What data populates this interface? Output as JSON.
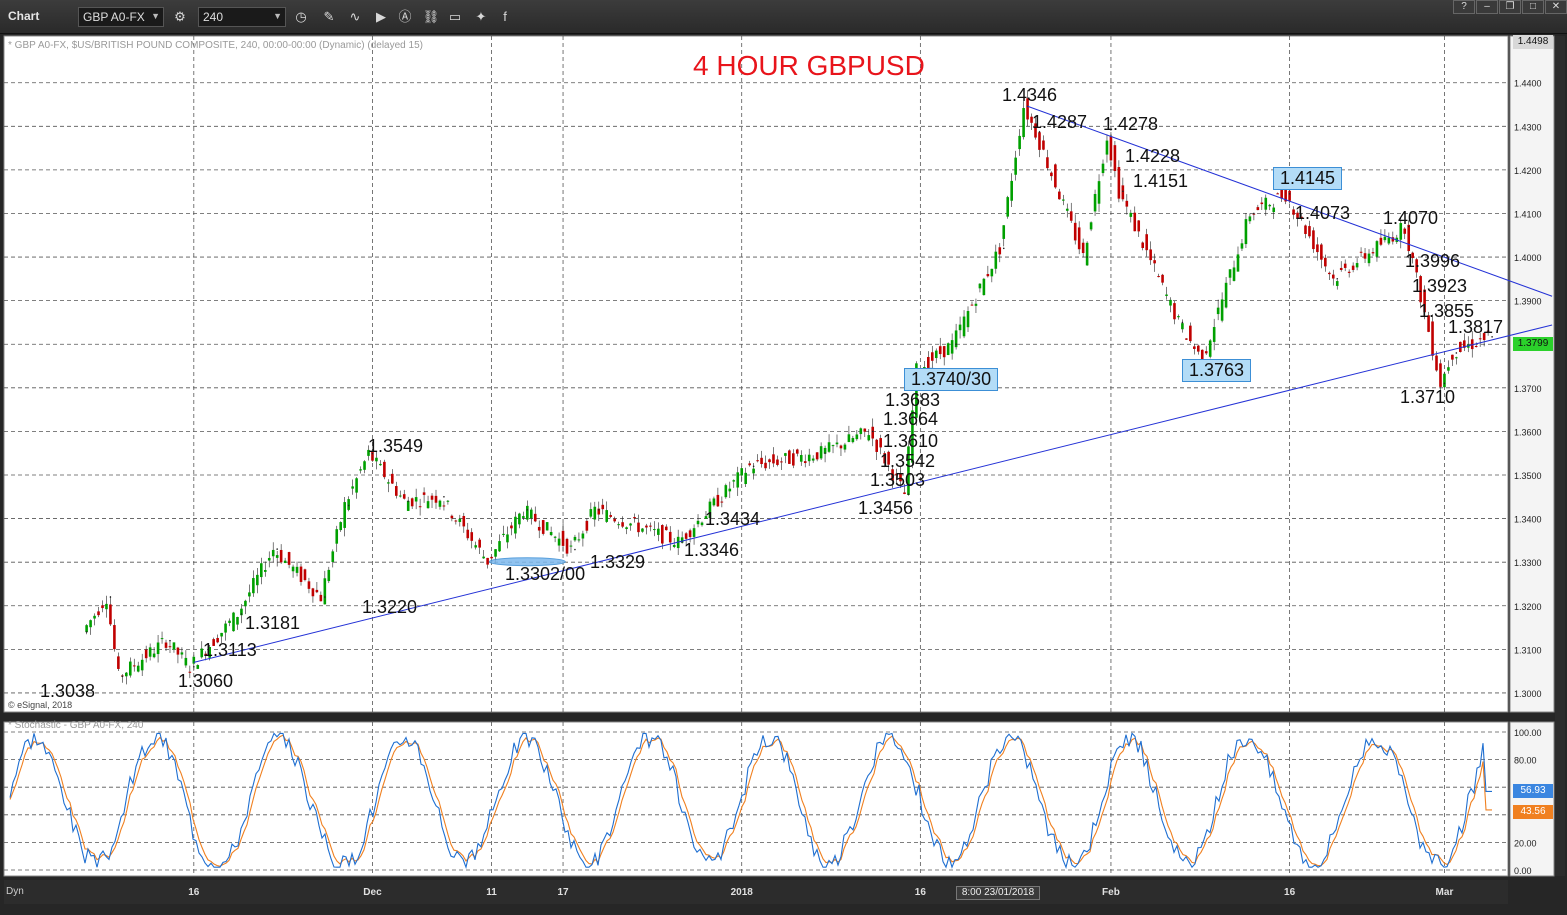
{
  "toolbar": {
    "window_title": "Chart",
    "symbol": "GBP A0-FX",
    "symbol_superscript": "15",
    "interval": "240"
  },
  "chart": {
    "symbol_notice": "* GBP A0-FX, $US/BRITISH POUND COMPOSITE, 240, 00:00-00:00 (Dynamic) (delayed 15)",
    "copyright": "© eSignal, 2018",
    "title": "4 HOUR GBPUSD",
    "stochastic_legend": "* Stochastic - GBP A0-FX, 240",
    "status_left": "Dyn",
    "crosshair_date": "8:00 23/01/2018"
  },
  "price_labels": [
    {
      "text": "1.4346"
    },
    {
      "text": "1.4287"
    },
    {
      "text": "1.4278"
    },
    {
      "text": "1.4228"
    },
    {
      "text": "1.4151"
    },
    {
      "text": "1.4073"
    },
    {
      "text": "1.4070"
    },
    {
      "text": "1.3996"
    },
    {
      "text": "1.3923"
    },
    {
      "text": "1.3855"
    },
    {
      "text": "1.3817"
    },
    {
      "text": "1.3710"
    },
    {
      "text": "1.3683"
    },
    {
      "text": "1.3664"
    },
    {
      "text": "1.3610"
    },
    {
      "text": "1.3542"
    },
    {
      "text": "1.3503"
    },
    {
      "text": "1.3456"
    },
    {
      "text": "1.3549"
    },
    {
      "text": "1.3434"
    },
    {
      "text": "1.3346"
    },
    {
      "text": "1.3329"
    },
    {
      "text": "1.3302/00"
    },
    {
      "text": "1.3220"
    },
    {
      "text": "1.3181"
    },
    {
      "text": "1.3113"
    },
    {
      "text": "1.3060"
    },
    {
      "text": "1.3038"
    }
  ],
  "boxed_labels": [
    {
      "text": "1.4145"
    },
    {
      "text": "1.3763"
    },
    {
      "text": "1.3740/30"
    }
  ],
  "right_tags": {
    "last_price": "1.3799",
    "top_price": "1.4498",
    "stoch_k": "56.93",
    "stoch_d": "43.56"
  },
  "colors": {
    "background": "#ffffff",
    "up_candle": "#00a000",
    "down_candle": "#c00000",
    "trendline": "#2432d6",
    "stoch_k": "#1f6fd1",
    "stoch_d": "#f08020",
    "title": "#e8141b"
  },
  "chart_data": {
    "type": "line",
    "title": "4 HOUR GBPUSD",
    "y_axis": {
      "ticks": [
        "1.4400",
        "1.4300",
        "1.4200",
        "1.4100",
        "1.4000",
        "1.3900",
        "1.3800",
        "1.3700",
        "1.3600",
        "1.3500",
        "1.3400",
        "1.3300",
        "1.3200",
        "1.3100",
        "1.3000"
      ],
      "ylim": [
        1.297,
        1.4498
      ]
    },
    "x_axis": {
      "ticks": [
        "16",
        "Dec",
        "11",
        "17",
        "2018",
        "16",
        "Feb",
        "16",
        "Mar"
      ]
    },
    "stochastic_axis": {
      "ticks": [
        "100.00",
        "80.00",
        "60.00",
        "40.00",
        "20.00",
        "0.00"
      ]
    },
    "price_series": {
      "name": "GBP A0-FX",
      "x": [
        "Nov 7",
        "Nov 9",
        "Nov 10",
        "Nov 14",
        "Nov 16",
        "Nov 20",
        "Nov 23",
        "Nov 27",
        "Nov 29",
        "Dec 1",
        "Dec 4",
        "Dec 7",
        "Dec 11",
        "Dec 14",
        "Dec 18",
        "Dec 20",
        "Dec 27",
        "Jan 2",
        "Jan 8",
        "Jan 12",
        "Jan 15",
        "Jan 16",
        "Jan 19",
        "Jan 23",
        "Jan 25",
        "Jan 26",
        "Jan 30",
        "Feb 1",
        "Feb 2",
        "Feb 7",
        "Feb 9",
        "Feb 13",
        "Feb 16",
        "Feb 20",
        "Feb 26",
        "Mar 1",
        "Mar 2",
        "Mar 5"
      ],
      "y": [
        1.314,
        1.322,
        1.3038,
        1.312,
        1.306,
        1.3181,
        1.333,
        1.322,
        1.343,
        1.3549,
        1.344,
        1.345,
        1.3302,
        1.342,
        1.3329,
        1.342,
        1.3346,
        1.352,
        1.355,
        1.36,
        1.3456,
        1.374,
        1.38,
        1.402,
        1.4346,
        1.4287,
        1.4,
        1.4278,
        1.4151,
        1.385,
        1.3763,
        1.41,
        1.4145,
        1.395,
        1.407,
        1.371,
        1.378,
        1.3817
      ]
    },
    "trendlines": [
      {
        "name": "support",
        "points": [
          [
            "Nov 16",
            1.307
          ],
          [
            "Mar 5",
            1.381
          ]
        ]
      },
      {
        "name": "resistance",
        "points": [
          [
            "Jan 25",
            1.4346
          ],
          [
            "Mar 5",
            1.396
          ]
        ]
      }
    ],
    "stochastic": {
      "k_last": 56.93,
      "d_last": 43.56
    }
  }
}
